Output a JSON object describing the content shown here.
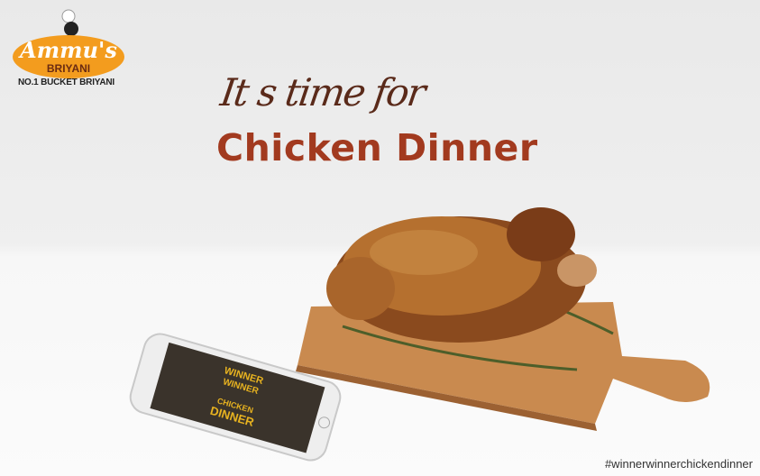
{
  "brand": {
    "logo_text": "Ammu's",
    "logo_subtext": "BRIYANI",
    "tagline": "NO.1 BUCKET BRIYANI",
    "color": "#f39c1e"
  },
  "headline": {
    "line1": "It s time for",
    "line2": "Chicken Dinner",
    "color": "#a23a1f"
  },
  "phone_screen": {
    "line1": "WINNER",
    "line2": "WINNER",
    "line3": "CHICKEN",
    "line4": "DINNER"
  },
  "hashtag": "#winnerwinnerchickendinner"
}
